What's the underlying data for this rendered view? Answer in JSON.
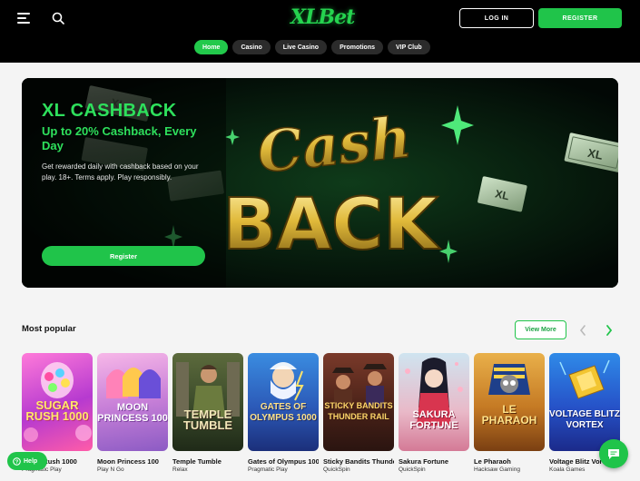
{
  "header": {
    "logo_text": "XLBet",
    "login_label": "LOG IN",
    "register_label": "REGISTER"
  },
  "nav": [
    {
      "label": "Home",
      "active": true
    },
    {
      "label": "Casino",
      "active": false
    },
    {
      "label": "Live Casino",
      "active": false
    },
    {
      "label": "Promotions",
      "active": false
    },
    {
      "label": "VIP Club",
      "active": false
    }
  ],
  "banner": {
    "title": "XL CASHBACK",
    "subtitle": "Up to 20% Cashback, Every Day",
    "description": "Get rewarded daily with cashback based on your play. 18+. Terms apply. Play responsibly.",
    "button_label": "Register",
    "art_text_top": "Cash",
    "art_text_bottom": "BACK",
    "bill_text": "XL"
  },
  "popular": {
    "title": "Most popular",
    "view_more_label": "View More"
  },
  "games": [
    {
      "name": "Sugar Rush 1000",
      "provider": "Pragmatic Play",
      "art": "SUGAR RUSH 1000"
    },
    {
      "name": "Moon Princess 100",
      "provider": "Play N Go",
      "art": "MOON PRINCESS 100"
    },
    {
      "name": "Temple Tumble",
      "provider": "Relax",
      "art": "TEMPLE TUMBLE"
    },
    {
      "name": "Gates of Olympus 1000",
      "provider": "Pragmatic Play",
      "art": "GATES OF OLYMPUS 1000"
    },
    {
      "name": "Sticky Bandits Thunder Rail",
      "provider": "QuickSpin",
      "art": "STICKY BANDITS THUNDER RAIL"
    },
    {
      "name": "Sakura Fortune",
      "provider": "QuickSpin",
      "art": "SAKURA FORTUNE"
    },
    {
      "name": "Le Pharaoh",
      "provider": "Hacksaw Gaming",
      "art": "LE PHARAOH"
    },
    {
      "name": "Voltage Blitz Vortex",
      "provider": "Koala Games",
      "art": "VOLTAGE BLITZ VORTEX"
    }
  ],
  "help_label": "Help",
  "colors": {
    "accent": "#20c44a",
    "header_bg": "#000000",
    "page_bg": "#f4f4f4"
  }
}
